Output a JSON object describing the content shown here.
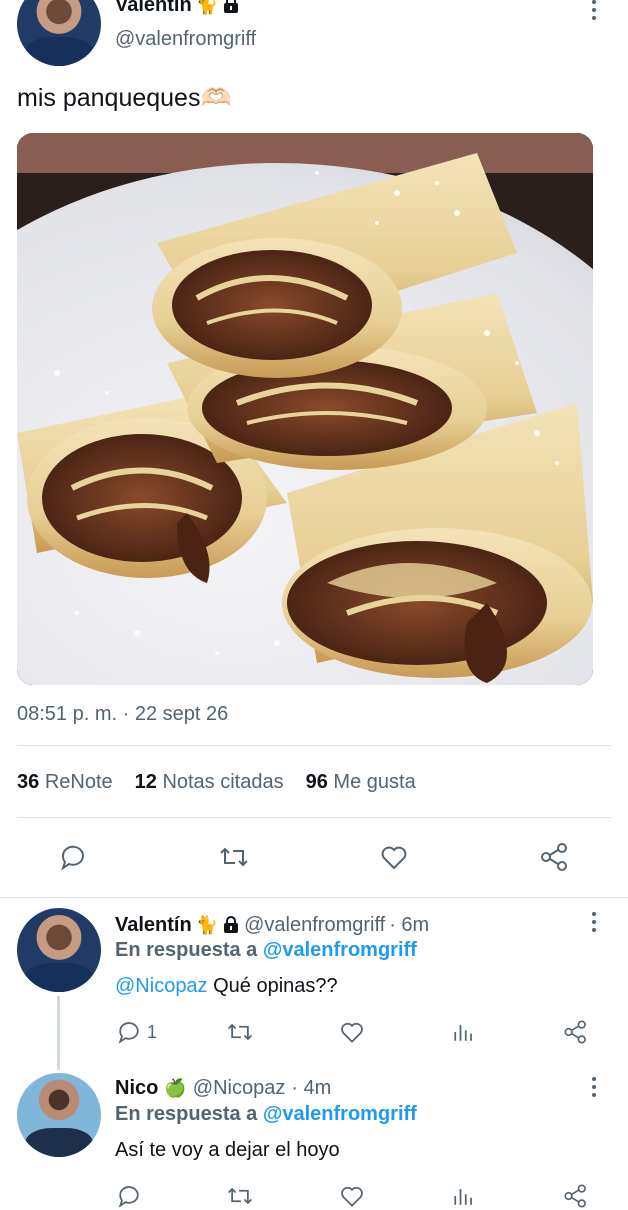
{
  "main_tweet": {
    "author_name": "Valentín",
    "author_emoji": "🐈",
    "lock_icon": "lock-icon",
    "handle": "@valenfromgriff",
    "text": "mis panqueques🫶🏻",
    "timestamp": "08:51 p. m. · 22 sept 26",
    "stats": {
      "renotes_count": "36",
      "renotes_label": "ReNote",
      "quotes_count": "12",
      "quotes_label": "Notas citadas",
      "likes_count": "96",
      "likes_label": "Me gusta"
    },
    "actions": [
      "reply-icon",
      "renote-icon",
      "like-icon",
      "share-icon"
    ]
  },
  "replies": [
    {
      "author_name": "Valentín",
      "author_emoji": "🐈",
      "handle": "@valenfromgriff",
      "time": "· 6m",
      "reply_prefix": "En respuesta a",
      "reply_to": "@valenfromgriff",
      "mention": "@Nicopaz",
      "text": "Qué opinas??",
      "reply_count": "1"
    },
    {
      "author_name": "Nico",
      "author_emoji": "🍏",
      "handle": "@Nicopaz",
      "time": "· 4m",
      "reply_prefix": "En respuesta a",
      "reply_to": "@valenfromgriff",
      "text": "Así te voy a dejar el hoyo"
    }
  ],
  "colors": {
    "accent": "#1d9bf0",
    "muted": "#536471",
    "text": "#0f1419",
    "divider": "#e1e4e8"
  }
}
